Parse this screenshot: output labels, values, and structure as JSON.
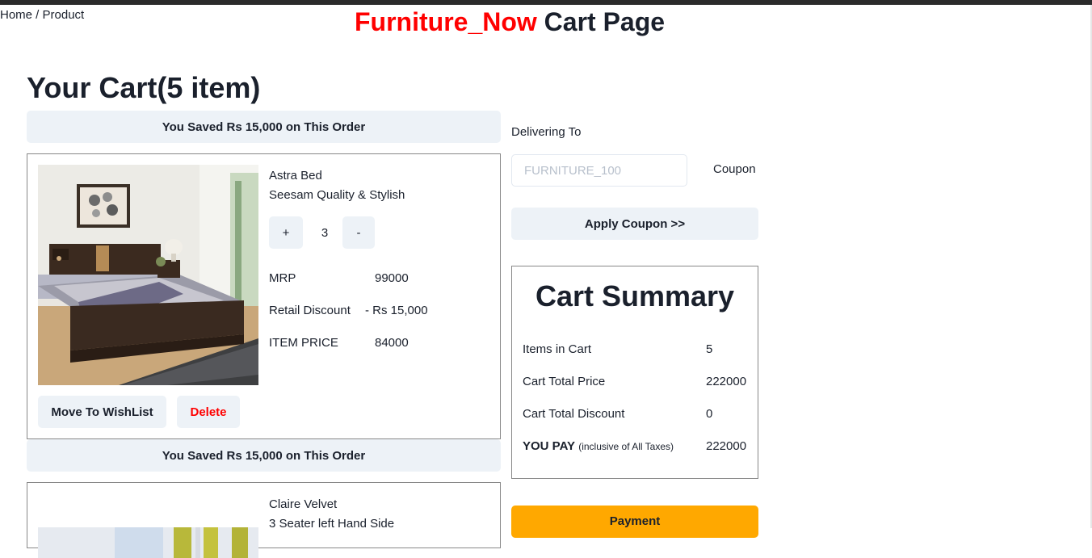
{
  "breadcrumb": "Home / Product",
  "title": {
    "brand": "Furniture_Now",
    "rest": " Cart Page"
  },
  "cart_heading": "Your Cart(5 item)",
  "items": [
    {
      "saved": "You Saved Rs 15,000 on This Order",
      "name": "Astra Bed",
      "desc": "Seesam Quality & Stylish",
      "plus": "+",
      "qty": "3",
      "minus": "-",
      "mrp_label": "MRP",
      "mrp": "99000",
      "discount_label": "Retail Discount",
      "discount": "- Rs 15,000",
      "price_label": "ITEM PRICE",
      "price": "84000",
      "wishlist_label": "Move To WishList",
      "delete_label": "Delete"
    },
    {
      "saved": "You Saved Rs 15,000 on This Order",
      "name": "Claire Velvet",
      "desc": "3 Seater left Hand Side"
    }
  ],
  "delivery": {
    "label": "Delivering To",
    "coupon_placeholder": "FURNITURE_100",
    "coupon_label": "Coupon",
    "apply_label": "Apply Coupon >>"
  },
  "summary": {
    "title": "Cart Summary",
    "rows": [
      {
        "label": "Items in Cart",
        "value": "5"
      },
      {
        "label": "Cart Total Price",
        "value": "222000"
      },
      {
        "label": "Cart Total Discount",
        "value": "0"
      }
    ],
    "you_pay": "YOU PAY",
    "you_pay_note": "(inclusive of All Taxes)",
    "you_pay_value": "222000"
  },
  "payment_label": "Payment",
  "colors": {
    "brand": "#ff0000",
    "button_bg": "#edf2f7",
    "payment": "#ffa800",
    "delete_text": "#ff0000"
  }
}
